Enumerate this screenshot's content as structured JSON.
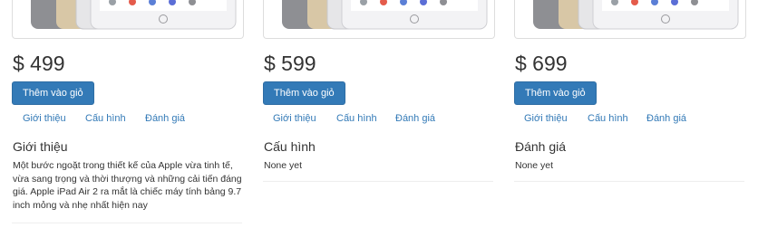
{
  "products": [
    {
      "price": "$ 499",
      "add_to_cart_label": "Thêm vào giỏ",
      "tabs": [
        "Giới thiệu",
        "Cấu hình",
        "Đánh giá"
      ],
      "active_section_title": "Giới thiệu",
      "active_section_body": "Một bước ngoặt trong thiết kế của Apple vừa tinh tế, vừa sang trọng và thời thượng và những cải tiến đáng giá. Apple iPad Air 2 ra mắt là chiếc máy tính bảng 9.7 inch mỏng và nhẹ nhất hiện nay"
    },
    {
      "price": "$ 599",
      "add_to_cart_label": "Thêm vào giỏ",
      "tabs": [
        "Giới thiệu",
        "Cấu hình",
        "Đánh giá"
      ],
      "active_section_title": "Cấu hình",
      "active_section_body": "None yet"
    },
    {
      "price": "$ 699",
      "add_to_cart_label": "Thêm vào giỏ",
      "tabs": [
        "Giới thiệu",
        "Cấu hình",
        "Đánh giá"
      ],
      "active_section_title": "Đánh giá",
      "active_section_body": "None yet"
    }
  ],
  "colors": {
    "primary_button": "#337ab7",
    "link": "#337ab7",
    "text": "#333333",
    "border": "#dddddd"
  }
}
